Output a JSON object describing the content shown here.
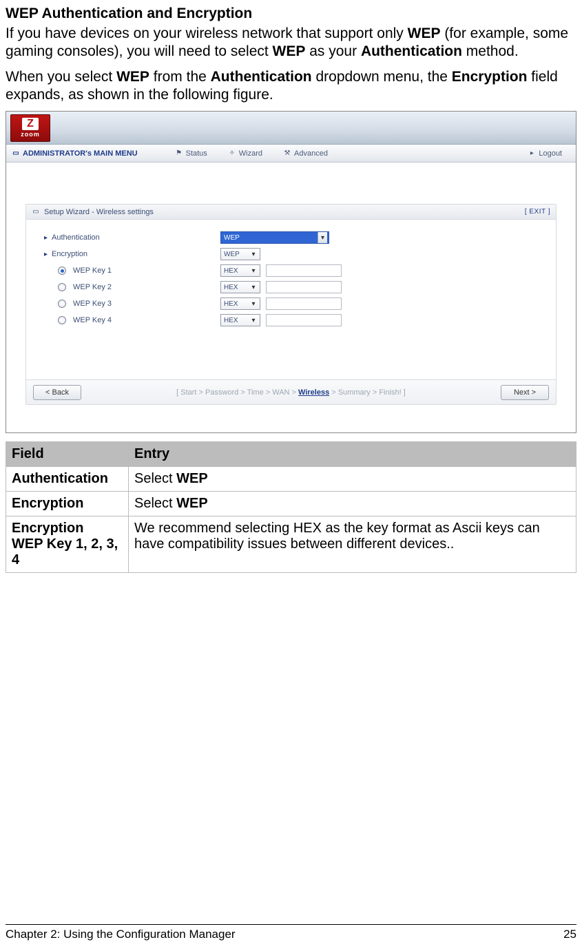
{
  "page": {
    "heading": "WEP Authentication and Encryption",
    "para1_a": "If you have devices on your wireless network that support only ",
    "para1_b": "WEP",
    "para1_c": " (for example, some gaming consoles), you will need to select ",
    "para1_d": "WEP",
    "para1_e": " as your ",
    "para1_f": "Authentication",
    "para1_g": " method.",
    "para2_a": "When you select ",
    "para2_b": "WEP",
    "para2_c": " from the ",
    "para2_d": "Authentication",
    "para2_e": " dropdown menu, the ",
    "para2_f": "Encryption",
    "para2_g": " field expands, as shown in the following figure."
  },
  "screenshot": {
    "logo_z": "Z",
    "logo_text": "zoom",
    "menu": {
      "main": "ADMINISTRATOR's MAIN MENU",
      "status": "Status",
      "wizard": "Wizard",
      "advanced": "Advanced",
      "logout": "Logout"
    },
    "panel": {
      "title": "Setup Wizard - Wireless settings",
      "exit": "[ EXIT ]",
      "auth_label": "Authentication",
      "auth_value": "WEP",
      "enc_label": "Encryption",
      "enc_value": "WEP",
      "keys": [
        {
          "label": "WEP Key 1",
          "fmt": "HEX",
          "checked": true
        },
        {
          "label": "WEP Key 2",
          "fmt": "HEX",
          "checked": false
        },
        {
          "label": "WEP Key 3",
          "fmt": "HEX",
          "checked": false
        },
        {
          "label": "WEP Key 4",
          "fmt": "HEX",
          "checked": false
        }
      ],
      "back": "< Back",
      "next": "Next >",
      "bc_prefix": "[ Start > Password > Time > WAN > ",
      "bc_current": "Wireless",
      "bc_suffix": " > Summary > Finish! ]"
    }
  },
  "table": {
    "head_field": "Field",
    "head_entry": "Entry",
    "rows": [
      {
        "field": "Authentication",
        "entry_a": "Select ",
        "entry_b": "WEP"
      },
      {
        "field": "Encryption",
        "entry_a": "Select ",
        "entry_b": "WEP"
      },
      {
        "field_a": "Encryption",
        "field_b": "WEP Key 1, 2, 3, 4",
        "entry": "We recommend selecting HEX as the key format as Ascii keys can have compatibility issues between different devices.."
      }
    ]
  },
  "footer": {
    "left": "Chapter 2: Using the Configuration Manager",
    "right": "25"
  }
}
